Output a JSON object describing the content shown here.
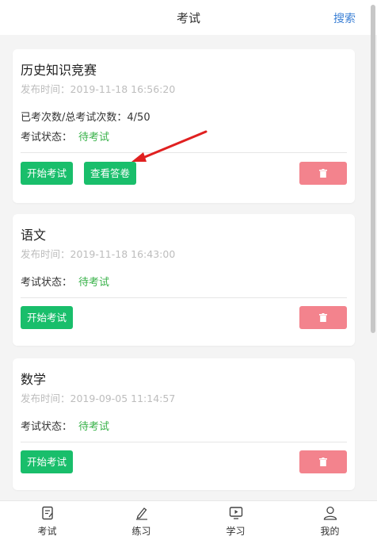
{
  "header": {
    "title": "考试",
    "search_label": "搜索"
  },
  "exams": [
    {
      "name": "历史知识竞赛",
      "publish_label": "发布时间：",
      "publish_time": "2019-11-18 16:56:20",
      "attempts_label": "已考次数/总考试次数：",
      "attempts_value": "4/50",
      "status_label": "考试状态：",
      "status_value": "待考试",
      "start_label": "开始考试",
      "view_label": "查看答卷"
    },
    {
      "name": "语文",
      "publish_label": "发布时间：",
      "publish_time": "2019-11-18 16:43:00",
      "status_label": "考试状态：",
      "status_value": "待考试",
      "start_label": "开始考试"
    },
    {
      "name": "数学",
      "publish_label": "发布时间：",
      "publish_time": "2019-09-05 11:14:57",
      "status_label": "考试状态：",
      "status_value": "待考试",
      "start_label": "开始考试"
    }
  ],
  "tabbar": [
    {
      "label": "考试",
      "icon": "exam-icon"
    },
    {
      "label": "练习",
      "icon": "pencil-icon"
    },
    {
      "label": "学习",
      "icon": "play-screen-icon"
    },
    {
      "label": "我的",
      "icon": "user-icon"
    }
  ],
  "colors": {
    "accent_green": "#19be6b",
    "status_green": "#38b249",
    "delete_pink": "#f3838d",
    "link_blue": "#3a7fd5",
    "annotation_red": "#e02020"
  }
}
